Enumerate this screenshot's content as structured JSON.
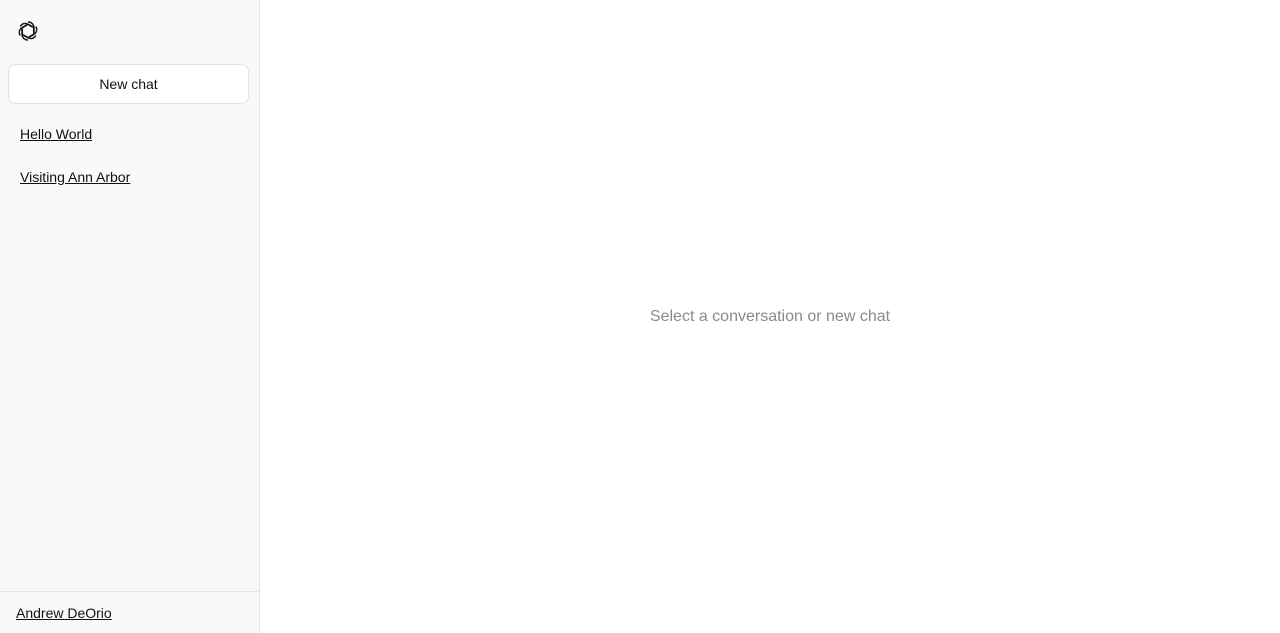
{
  "sidebar": {
    "logo_icon": "openai-logo-icon",
    "new_chat_label": "New chat",
    "conversations": [
      {
        "title": "Hello World"
      },
      {
        "title": "Visiting Ann Arbor"
      }
    ],
    "user_name": "Andrew DeOrio"
  },
  "main": {
    "empty_state": "Select a conversation or new chat"
  },
  "colors": {
    "sidebar_bg": "#f9f9f9",
    "border": "#e5e5e5",
    "muted_text": "#8a8a8a"
  }
}
